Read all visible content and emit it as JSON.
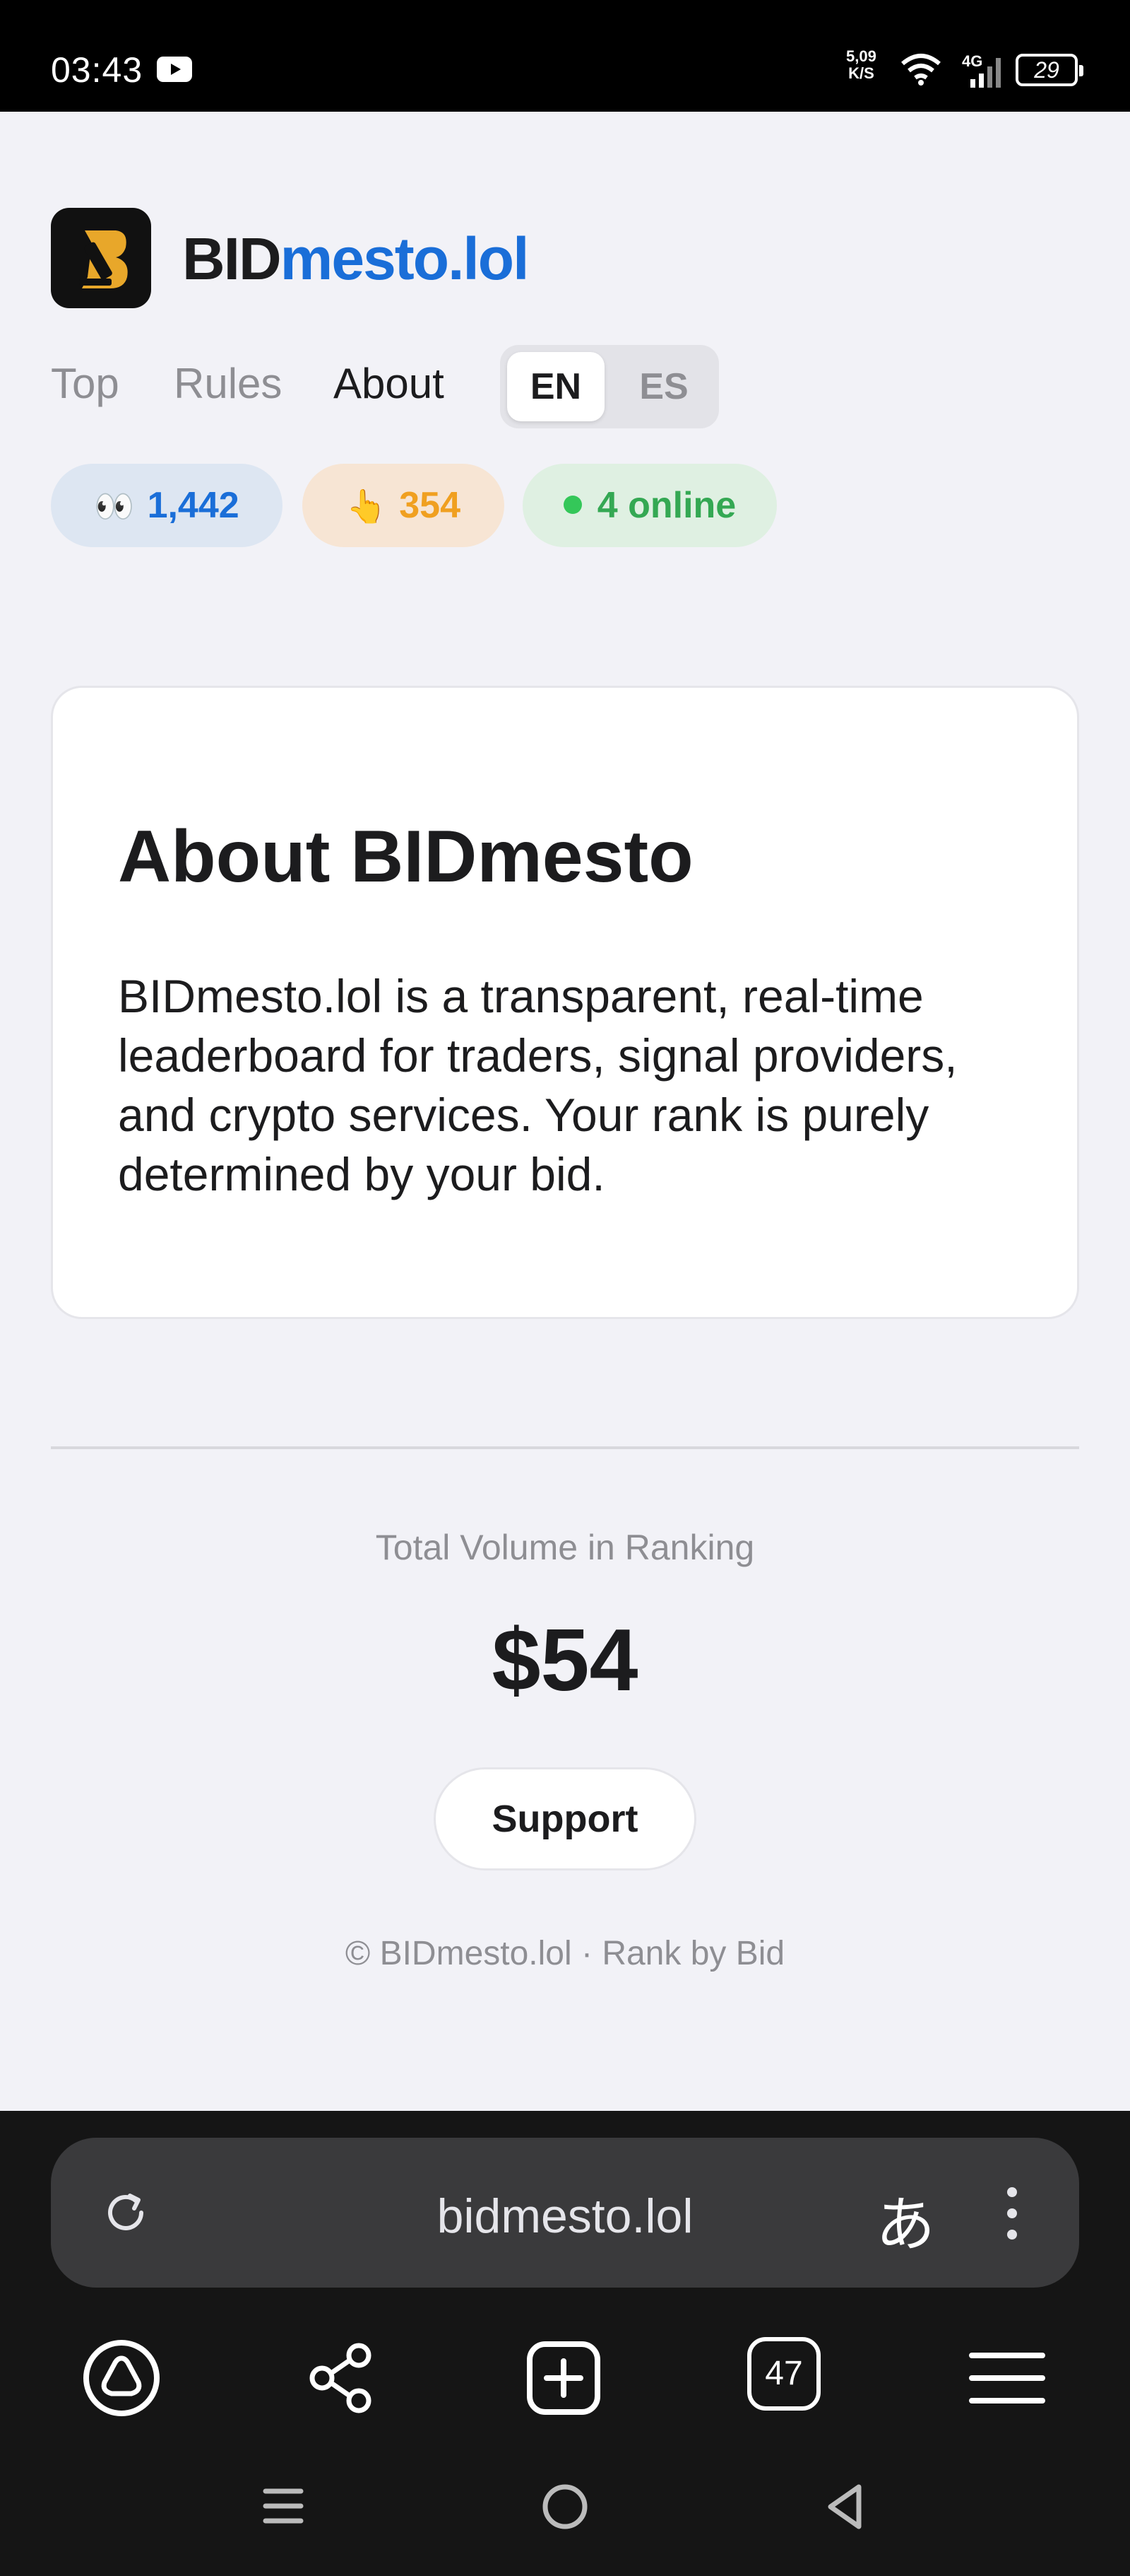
{
  "status_bar": {
    "time": "03:43",
    "net_speed_value": "5,09",
    "net_speed_unit": "K/S",
    "network": "4G",
    "battery": "29"
  },
  "header": {
    "brand_part1": "BID",
    "brand_part2": "mesto.lol"
  },
  "nav": {
    "items": [
      "Top",
      "Rules",
      "About"
    ],
    "active": "About"
  },
  "language": {
    "options": [
      "EN",
      "ES"
    ],
    "selected": "EN"
  },
  "stats": {
    "views": {
      "icon": "👀",
      "value": "1,442"
    },
    "taps": {
      "icon": "👆",
      "value": "354"
    },
    "online": {
      "value": "4 online"
    }
  },
  "about_card": {
    "title": "About BIDmesto",
    "body": "BIDmesto.lol is a transparent, real-time leaderboard for traders, signal providers, and crypto services. Your rank is purely determined by your bid."
  },
  "volume": {
    "label": "Total Volume in Ranking",
    "value": "$54"
  },
  "support_label": "Support",
  "footer": "© BIDmesto.lol · Rank by Bid",
  "browser": {
    "url": "bidmesto.lol",
    "tab_count": "47",
    "translate_glyph": "あ"
  },
  "colors": {
    "accent": "#1a6ed8",
    "views_bg": "#dde6f2",
    "taps_color": "#f0a020",
    "online_color": "#34a853"
  }
}
